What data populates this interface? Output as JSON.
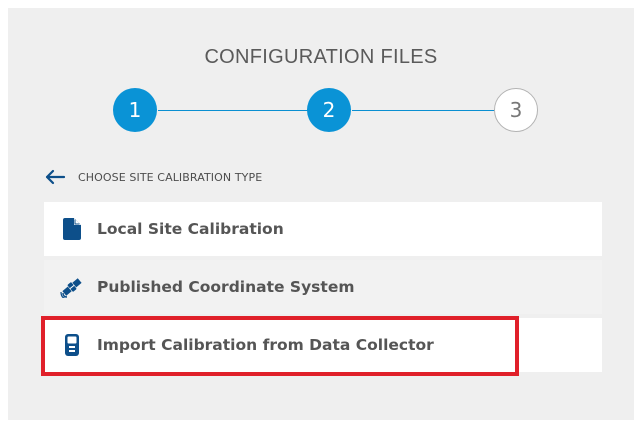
{
  "title": "CONFIGURATION FILES",
  "steps": [
    {
      "label": "1",
      "state": "active"
    },
    {
      "label": "2",
      "state": "active"
    },
    {
      "label": "3",
      "state": "inactive"
    }
  ],
  "back": {
    "icon": "arrow-left-icon",
    "label": "CHOOSE SITE CALIBRATION TYPE"
  },
  "options": [
    {
      "icon": "document-icon",
      "label": "Local Site Calibration"
    },
    {
      "icon": "satellite-icon",
      "label": "Published Coordinate System"
    },
    {
      "icon": "data-collector-icon",
      "label": "Import Calibration from Data Collector",
      "highlighted": true
    }
  ],
  "colors": {
    "accent": "#0a93d6",
    "icon": "#0d4f8a",
    "highlight": "#e0202a",
    "panel": "#efefef"
  }
}
